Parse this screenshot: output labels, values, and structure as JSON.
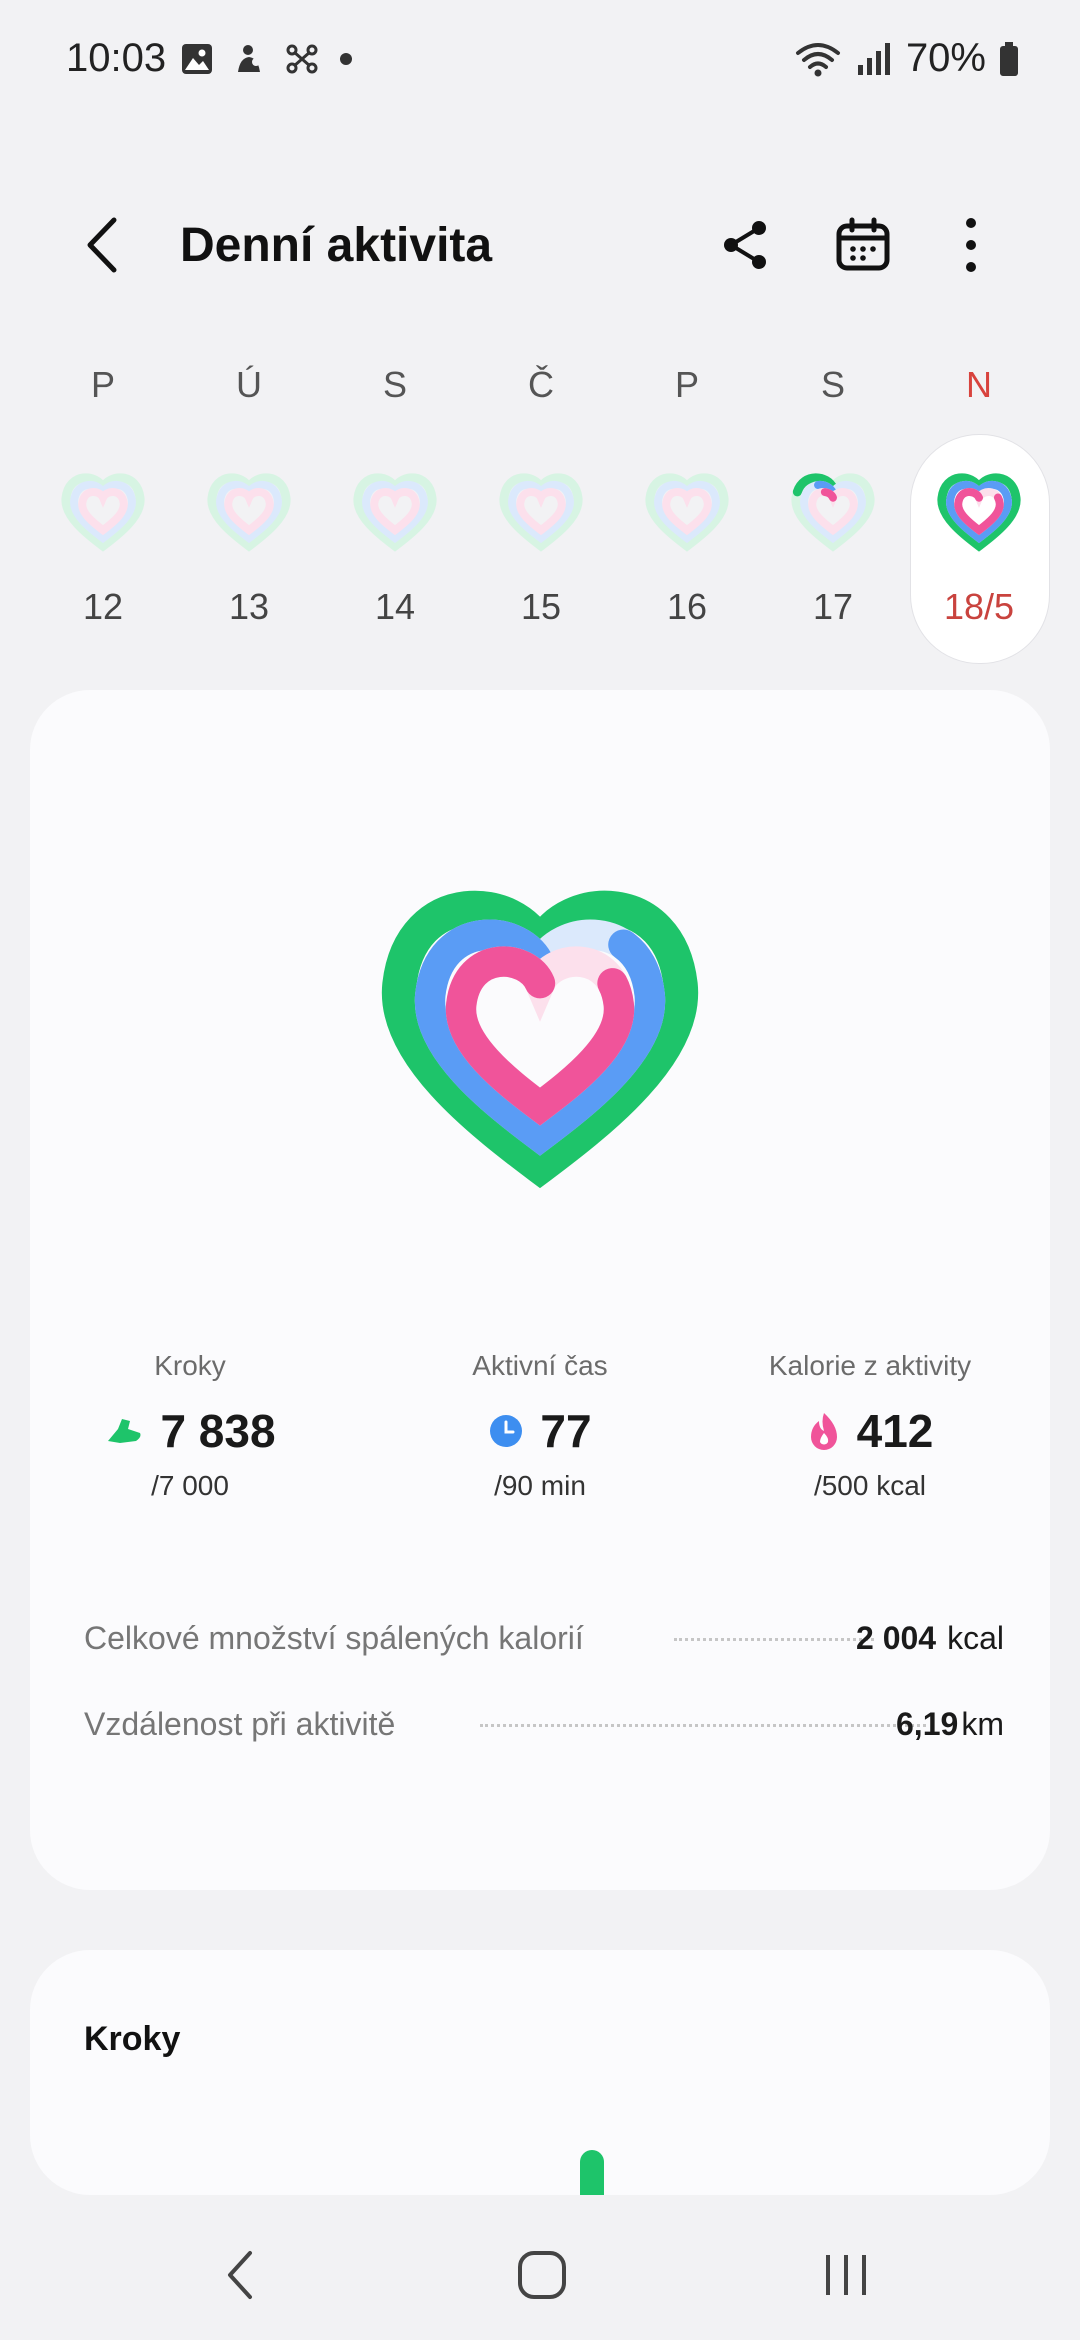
{
  "status_bar": {
    "time": "10:03",
    "battery": "70%"
  },
  "header": {
    "title": "Denní aktivita"
  },
  "week": {
    "days": [
      {
        "letter": "P",
        "number": "12",
        "progress": [
          0,
          0,
          0
        ]
      },
      {
        "letter": "Ú",
        "number": "13",
        "progress": [
          0,
          0,
          0
        ]
      },
      {
        "letter": "S",
        "number": "14",
        "progress": [
          0,
          0,
          0
        ]
      },
      {
        "letter": "Č",
        "number": "15",
        "progress": [
          0,
          0,
          0
        ]
      },
      {
        "letter": "P",
        "number": "16",
        "progress": [
          0,
          0,
          0
        ]
      },
      {
        "letter": "S",
        "number": "17",
        "progress": [
          0.2,
          0.1,
          0.08
        ]
      },
      {
        "letter": "N",
        "number": "18/5",
        "progress": [
          1,
          1,
          0.82
        ],
        "selected": true
      }
    ]
  },
  "summary": {
    "progress": {
      "steps": 1.0,
      "active_time": 0.86,
      "calories": 0.82
    },
    "stats": [
      {
        "label": "Kroky",
        "value": "7 838",
        "goal": "/7 000",
        "icon": "shoe-icon",
        "color": "#1ec46a"
      },
      {
        "label": "Aktivní čas",
        "value": "77",
        "goal": "/90 min",
        "icon": "clock-icon",
        "color": "#3d8ef0"
      },
      {
        "label": "Kalorie z aktivity",
        "value": "412",
        "goal": "/500 kcal",
        "icon": "flame-icon",
        "color": "#f0549a"
      }
    ],
    "total_calories": {
      "label": "Celkové množství spálených kalorií",
      "value": "2 004",
      "unit": "kcal"
    },
    "distance": {
      "label": "Vzdálenost při aktivitě",
      "value": "6,19",
      "unit": "km"
    }
  },
  "steps_card": {
    "title": "Kroky"
  },
  "colors": {
    "green": "#1ec46a",
    "blue": "#5a9cf5",
    "pink": "#f0549a",
    "sunday": "#d8433d"
  }
}
